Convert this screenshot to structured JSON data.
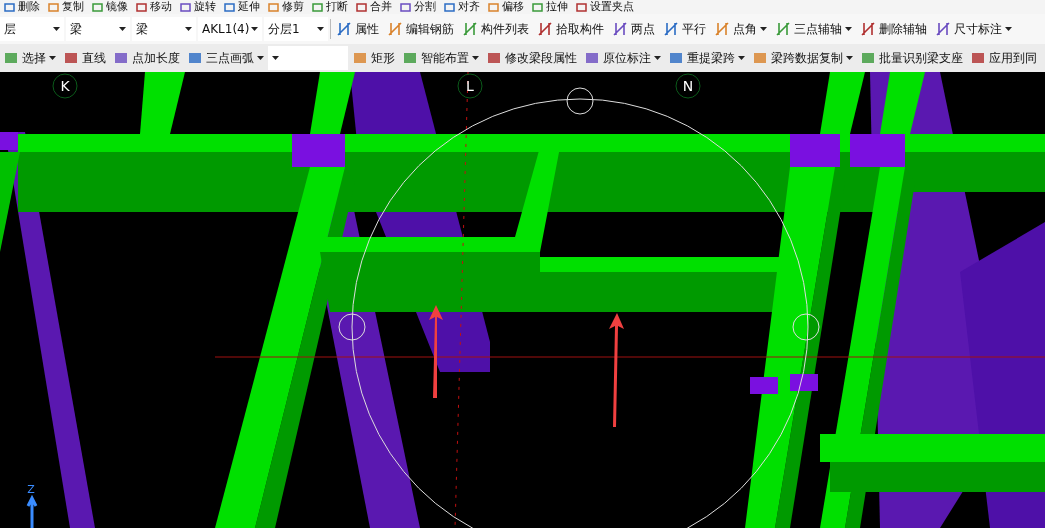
{
  "toolbar_top": [
    {
      "label": "删除"
    },
    {
      "label": "复制"
    },
    {
      "label": "镜像"
    },
    {
      "label": "移动"
    },
    {
      "label": "旋转"
    },
    {
      "label": "延伸"
    },
    {
      "label": "修剪"
    },
    {
      "label": "打断"
    },
    {
      "label": "合并"
    },
    {
      "label": "分割"
    },
    {
      "label": "对齐"
    },
    {
      "label": "偏移"
    },
    {
      "label": "拉伸"
    },
    {
      "label": "设置夹点"
    }
  ],
  "selectors": [
    {
      "value": "层"
    },
    {
      "value": "梁"
    },
    {
      "value": "梁"
    },
    {
      "value": "AKL1(4)"
    },
    {
      "value": "分层1"
    }
  ],
  "toolbar_middle": [
    {
      "label": "属性",
      "dropdown": false
    },
    {
      "label": "编辑钢筋",
      "dropdown": false
    },
    {
      "label": "构件列表",
      "dropdown": false
    },
    {
      "label": "拾取构件",
      "dropdown": false
    },
    {
      "label": "两点",
      "dropdown": false
    },
    {
      "label": "平行",
      "dropdown": false
    },
    {
      "label": "点角",
      "dropdown": true
    },
    {
      "label": "三点辅轴",
      "dropdown": true
    },
    {
      "label": "删除辅轴",
      "dropdown": false
    },
    {
      "label": "尺寸标注",
      "dropdown": true
    }
  ],
  "toolbar_bottom": [
    {
      "label": "选择",
      "dropdown": true
    },
    {
      "label": "直线",
      "dropdown": false
    },
    {
      "label": "点加长度",
      "dropdown": false
    },
    {
      "label": "三点画弧",
      "dropdown": true
    },
    {
      "label": "矩形",
      "dropdown": false
    },
    {
      "label": "智能布置",
      "dropdown": true
    },
    {
      "label": "修改梁段属性",
      "dropdown": false
    },
    {
      "label": "原位标注",
      "dropdown": true
    },
    {
      "label": "重提梁跨",
      "dropdown": true
    },
    {
      "label": "梁跨数据复制",
      "dropdown": true
    },
    {
      "label": "批量识别梁支座",
      "dropdown": false
    },
    {
      "label": "应用到同",
      "dropdown": false
    }
  ],
  "axis_labels": [
    "K",
    "L",
    "N"
  ],
  "view_axis": "Z"
}
